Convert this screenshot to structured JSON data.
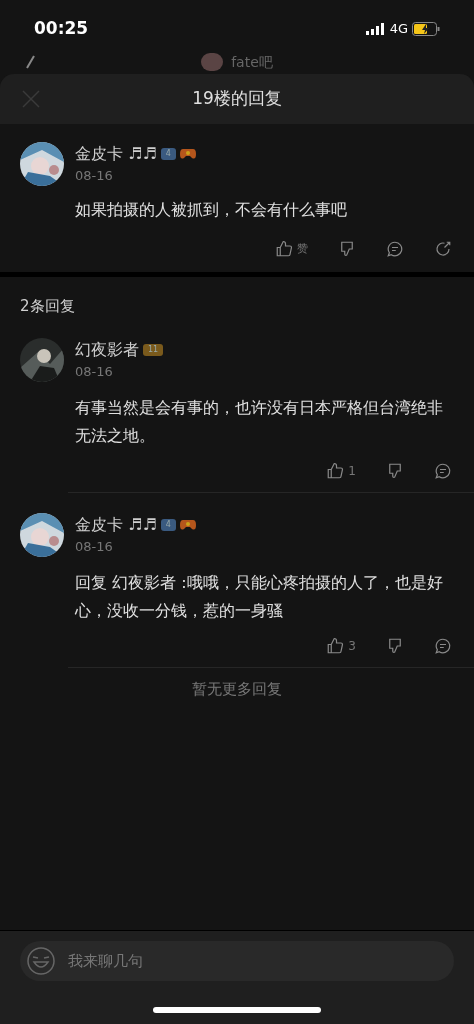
{
  "status_bar": {
    "time": "00:25",
    "network": "4G"
  },
  "background_header": {
    "title": "fate吧"
  },
  "sheet": {
    "title": "19楼的回复"
  },
  "main_post": {
    "user": "金皮卡 ♬♬",
    "level": "4",
    "color": "#3a5a80",
    "game_badge": true,
    "date": "08-16",
    "text": "如果拍摄的人被抓到，不会有什么事吧",
    "like_label": "赞"
  },
  "replies_header": "2条回复",
  "replies": [
    {
      "user": "幻夜影者",
      "level": "11",
      "color": "#7a5a1c",
      "game_badge": false,
      "date": "08-16",
      "text": "有事当然是会有事的，也许没有日本严格但台湾绝非无法之地。",
      "likes": "1"
    },
    {
      "user": "金皮卡 ♬♬",
      "level": "4",
      "color": "#3a5a80",
      "game_badge": true,
      "date": "08-16",
      "text": "回复 幻夜影者 :哦哦，只能心疼拍摄的人了，也是好心，没收一分钱，惹的一身骚",
      "likes": "3"
    }
  ],
  "end_note": "暂无更多回复",
  "composer": {
    "placeholder": "我来聊几句"
  }
}
